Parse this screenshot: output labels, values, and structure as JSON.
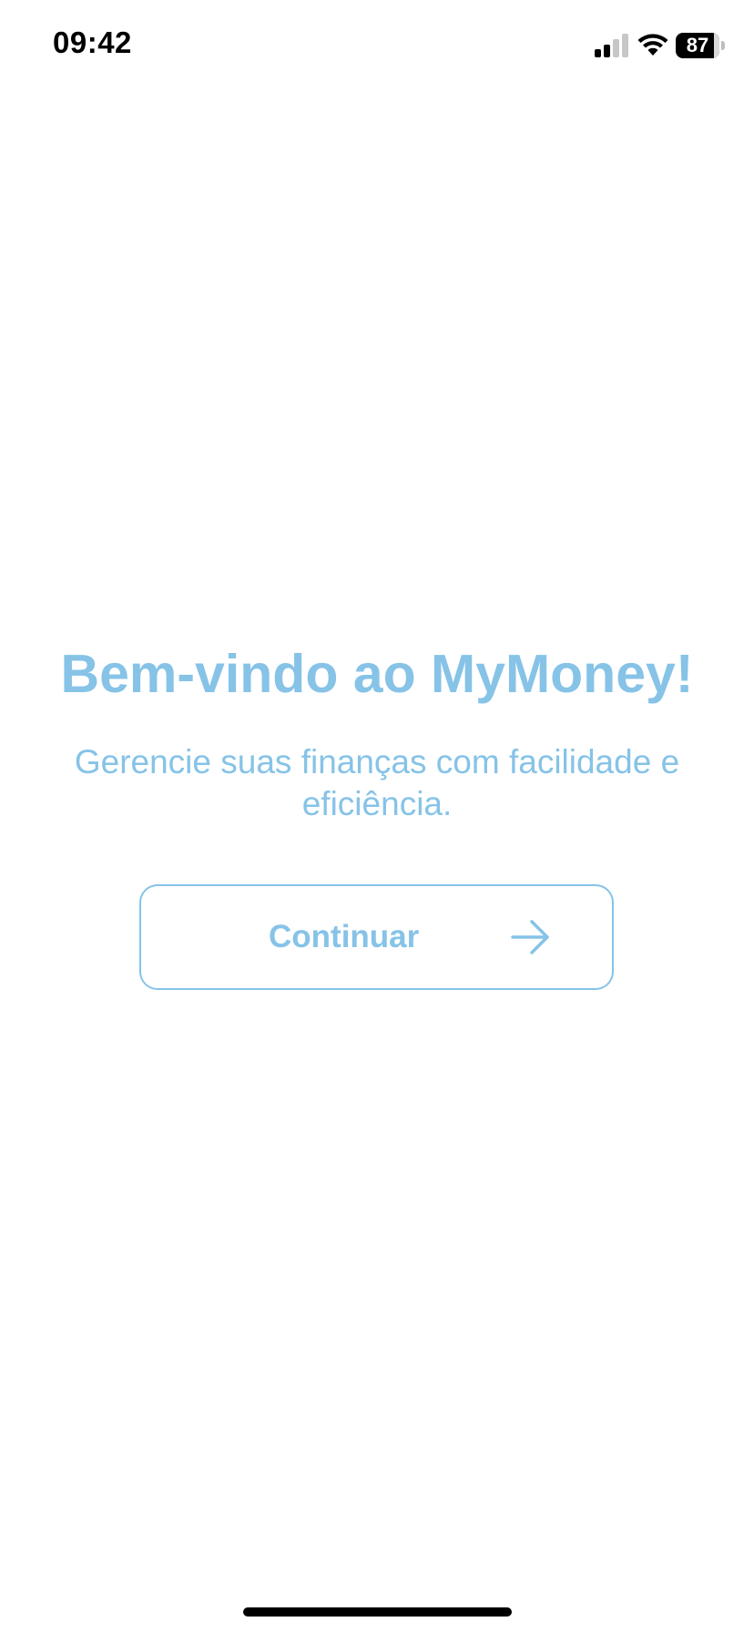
{
  "status_bar": {
    "time": "09:42",
    "battery": "87",
    "icons": [
      "signal-icon",
      "wifi-icon",
      "battery-icon"
    ]
  },
  "welcome": {
    "title": "Bem-vindo ao MyMoney!",
    "subtitle": "Gerencie suas finanças com facilidade e eficiência."
  },
  "continue_button": {
    "label": "Continuar",
    "icon": "arrow-right-icon"
  },
  "colors": {
    "accent": "#86c3e7",
    "background": "#ffffff"
  }
}
